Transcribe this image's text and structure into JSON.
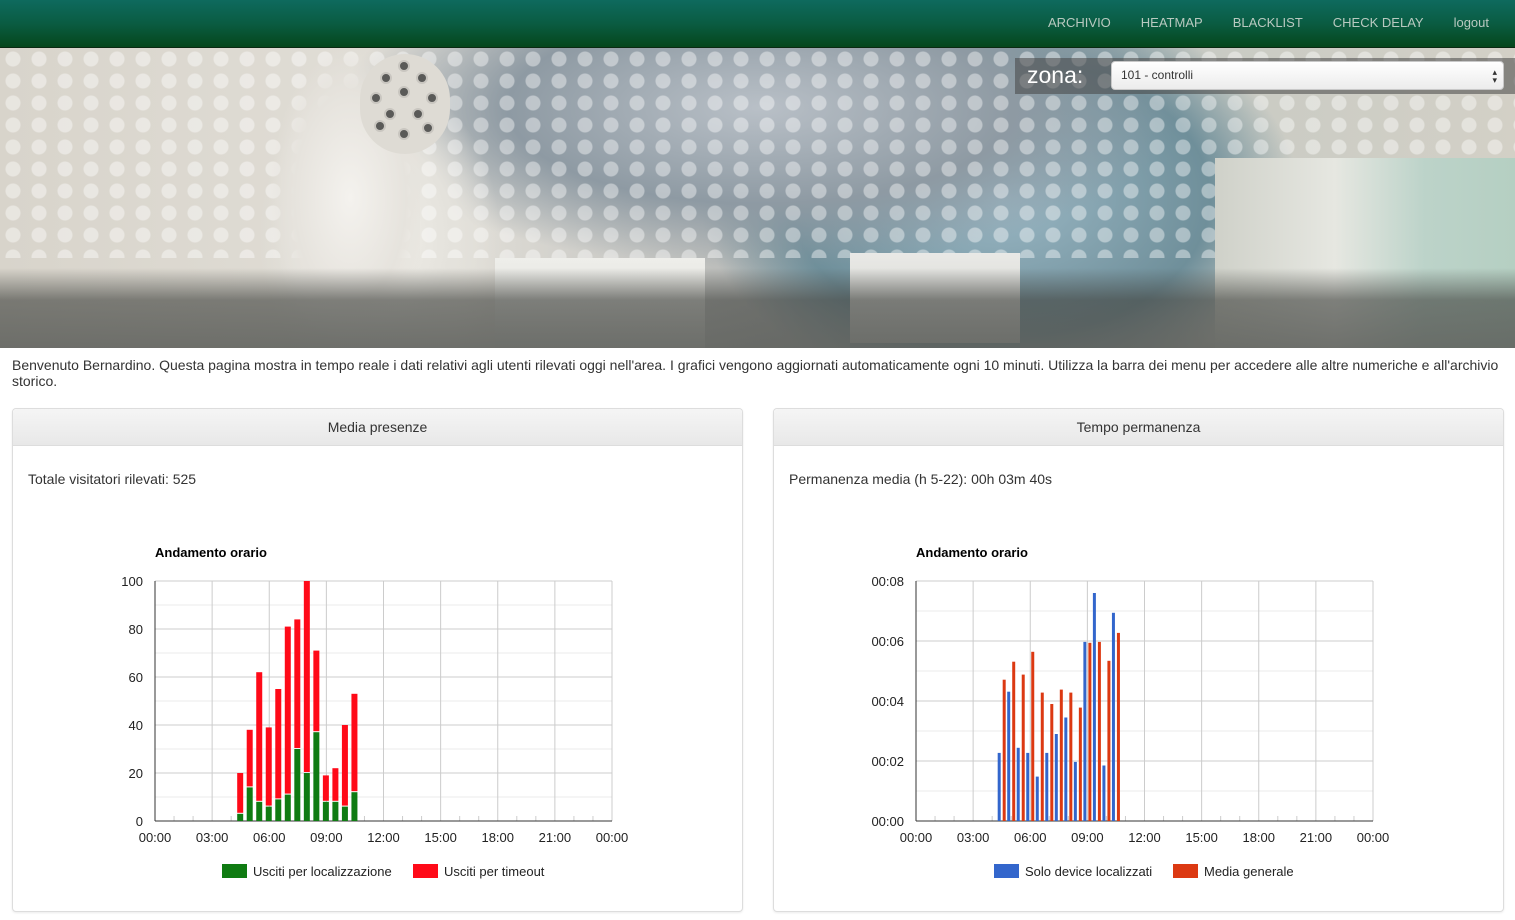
{
  "navbar": {
    "items": [
      {
        "label": "ARCHIVIO"
      },
      {
        "label": "HEATMAP"
      },
      {
        "label": "BLACKLIST"
      },
      {
        "label": "CHECK DELAY"
      },
      {
        "label": "logout"
      }
    ],
    "background_color": "#0a5c42"
  },
  "zona": {
    "label": "zona:",
    "selected": "101 - controlli"
  },
  "intro_text": "Benvenuto Bernardino. Questa pagina mostra in tempo reale i dati relativi agli utenti rilevati oggi nell'area. I grafici vengono aggiornati automaticamente ogni 10 minuti. Utilizza la barra dei menu per accedere alle altre numeriche e all'archivio storico.",
  "panels": {
    "left": {
      "title": "Media presenze",
      "stat": "Totale visitatori rilevati: 525"
    },
    "right": {
      "title": "Tempo permanenza",
      "stat": "Permanenza media (h 5-22): 00h 03m 40s"
    }
  },
  "chart_data": [
    {
      "type": "bar",
      "stacked": true,
      "title": "Andamento orario",
      "xlabel": "",
      "ylabel": "",
      "x_ticks": [
        "00:00",
        "03:00",
        "06:00",
        "09:00",
        "12:00",
        "15:00",
        "18:00",
        "21:00",
        "00:00"
      ],
      "xlim_hours": [
        0,
        24
      ],
      "y_ticks": [
        "0",
        "20",
        "40",
        "60",
        "80",
        "100"
      ],
      "ylim": [
        0,
        100
      ],
      "grid": true,
      "legend_position": "bottom",
      "x": [
        "04:30",
        "05:00",
        "05:30",
        "06:00",
        "06:30",
        "07:00",
        "07:30",
        "08:00",
        "08:30",
        "09:00",
        "09:30",
        "10:00",
        "10:30"
      ],
      "series": [
        {
          "name": "Usciti per localizzazione",
          "color": "#0f7b12",
          "values": [
            3,
            14,
            8,
            6,
            9,
            11,
            30,
            20,
            37,
            8,
            8,
            6,
            12
          ]
        },
        {
          "name": "Usciti per timeout",
          "color": "#ff0a18",
          "values": [
            17,
            24,
            54,
            33,
            46,
            70,
            54,
            80,
            34,
            11,
            14,
            34,
            41
          ]
        }
      ],
      "totals": [
        20,
        38,
        62,
        39,
        55,
        81,
        84,
        100,
        71,
        19,
        22,
        40,
        53
      ]
    },
    {
      "type": "bar",
      "stacked": false,
      "title": "Andamento orario",
      "xlabel": "",
      "ylabel": "",
      "x_ticks": [
        "00:00",
        "03:00",
        "06:00",
        "09:00",
        "12:00",
        "15:00",
        "18:00",
        "21:00",
        "00:00"
      ],
      "xlim_hours": [
        0,
        24
      ],
      "y_ticks": [
        "00:00",
        "00:02",
        "00:04",
        "00:06",
        "00:08"
      ],
      "ylim_minutes": [
        0,
        8
      ],
      "grid": true,
      "legend_position": "bottom",
      "x": [
        "04:30",
        "05:00",
        "05:30",
        "06:00",
        "06:30",
        "07:00",
        "07:30",
        "08:00",
        "08:30",
        "09:00",
        "09:30",
        "10:00",
        "10:30"
      ],
      "series": [
        {
          "name": "Solo device localizzati",
          "color": "#3366cc",
          "values_minutes": [
            2.27,
            4.31,
            2.44,
            2.27,
            1.48,
            2.27,
            2.9,
            3.45,
            1.97,
            5.97,
            7.6,
            1.85,
            6.94
          ]
        },
        {
          "name": "Media generale",
          "color": "#dc3912",
          "values_minutes": [
            4.71,
            5.31,
            4.88,
            5.64,
            4.28,
            3.9,
            4.38,
            4.28,
            3.78,
            5.94,
            5.97,
            5.34,
            6.27
          ]
        }
      ]
    }
  ]
}
